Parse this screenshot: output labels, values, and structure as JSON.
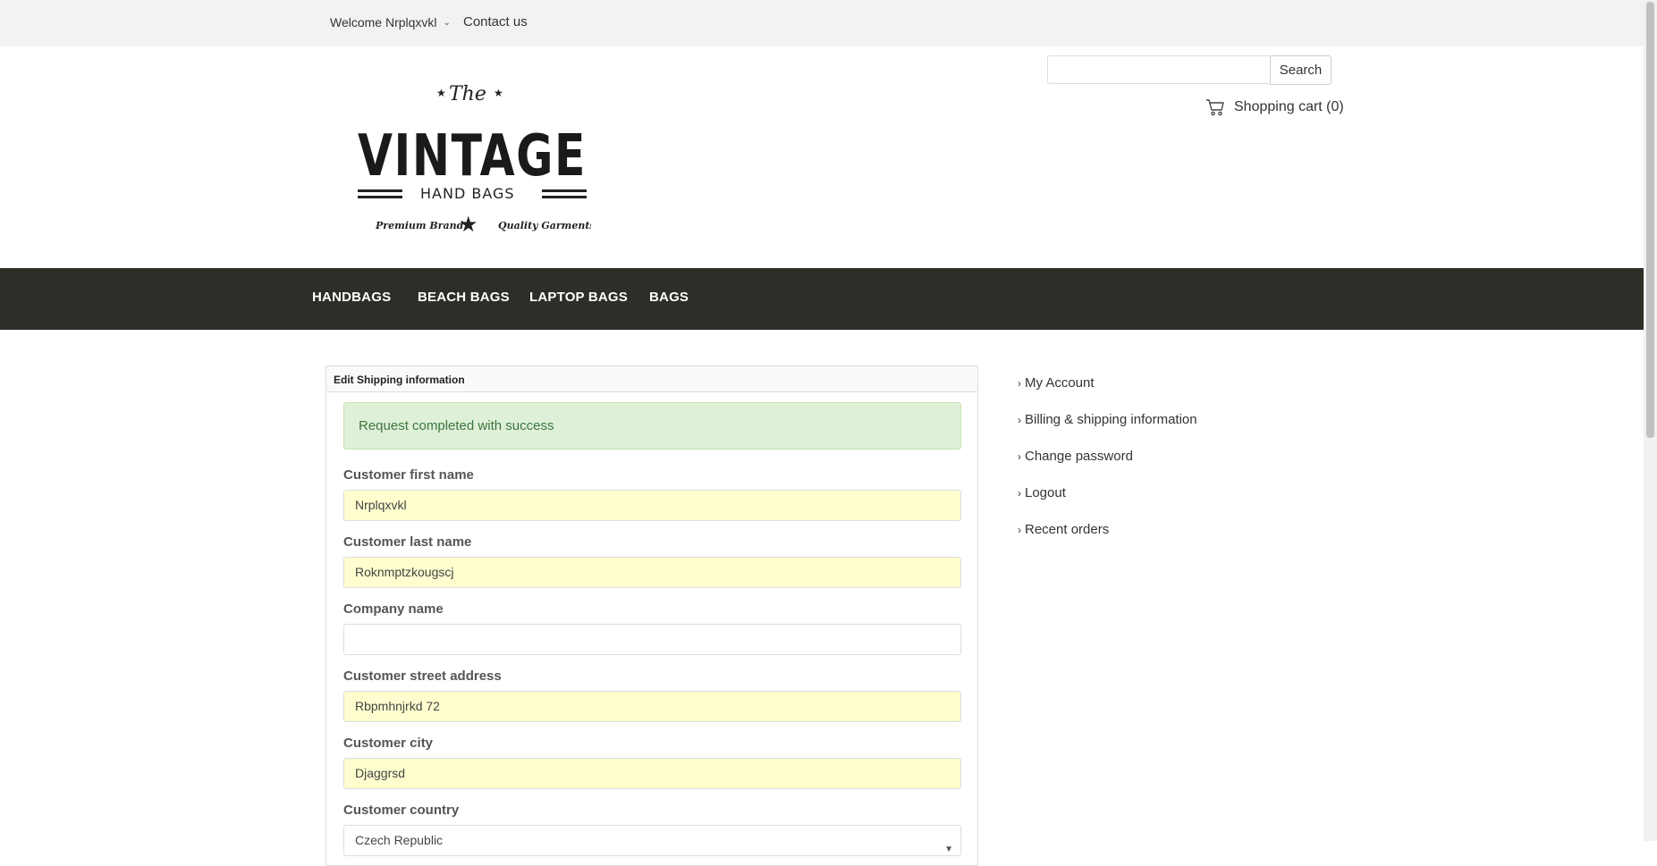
{
  "header": {
    "welcome": "Welcome Nrplqxvkl",
    "contact": "Contact us",
    "search": {
      "placeholder": "",
      "button": "Search"
    },
    "cart": "Shopping cart (0)"
  },
  "logo": {
    "the": "The",
    "brand": "VINTAGE",
    "sub": "HAND BAGS",
    "left_tag": "Premium Brand",
    "right_tag": "Quality Garments"
  },
  "nav": [
    "HANDBAGS",
    "BEACH BAGS",
    "LAPTOP BAGS",
    "BAGS"
  ],
  "form": {
    "title": "Edit Shipping information",
    "alert": "Request completed with success",
    "fields": [
      {
        "label": "Customer first name",
        "value": "Nrplqxvkl"
      },
      {
        "label": "Customer last name",
        "value": "Roknmptzkougscj"
      },
      {
        "label": "Company name",
        "value": ""
      },
      {
        "label": "Customer street address",
        "value": "Rbpmhnjrkd 72"
      },
      {
        "label": "Customer city",
        "value": "Djaggrsd"
      },
      {
        "label": "Customer country",
        "value": "Czech Republic"
      }
    ]
  },
  "sidebar": [
    "My Account",
    "Billing & shipping information",
    "Change password",
    "Logout",
    "Recent orders"
  ]
}
